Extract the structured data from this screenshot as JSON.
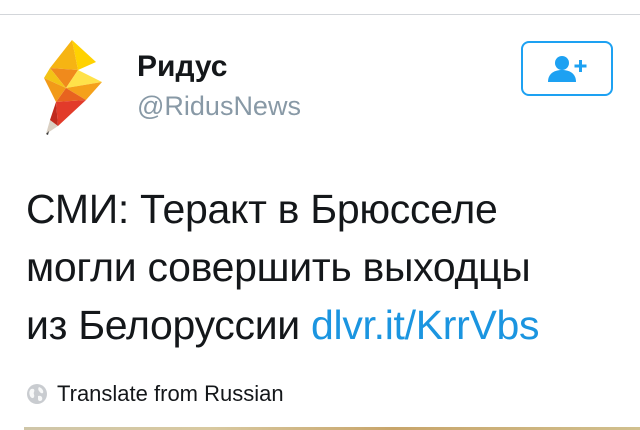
{
  "colors": {
    "accent": "#1da1f2",
    "link": "#1b95e0",
    "text": "#14171a",
    "muted": "#8899a6",
    "logo_yellow": "#ffd200",
    "logo_orange": "#f08a1c",
    "logo_red": "#e23b2a"
  },
  "account": {
    "avatar_icon": "ridus-lightning-pencil-logo",
    "display_name": "Ридус",
    "handle": "@RidusNews"
  },
  "follow_button": {
    "icon": "add-user-icon"
  },
  "tweet": {
    "line1": "СМИ: Теракт в Брюсселе",
    "line2": "могли совершить выходцы",
    "line3_text": "из Белоруссии ",
    "link": "dlvr.it/KrrVbs"
  },
  "translate": {
    "icon": "globe-icon",
    "label": "Translate from Russian"
  }
}
